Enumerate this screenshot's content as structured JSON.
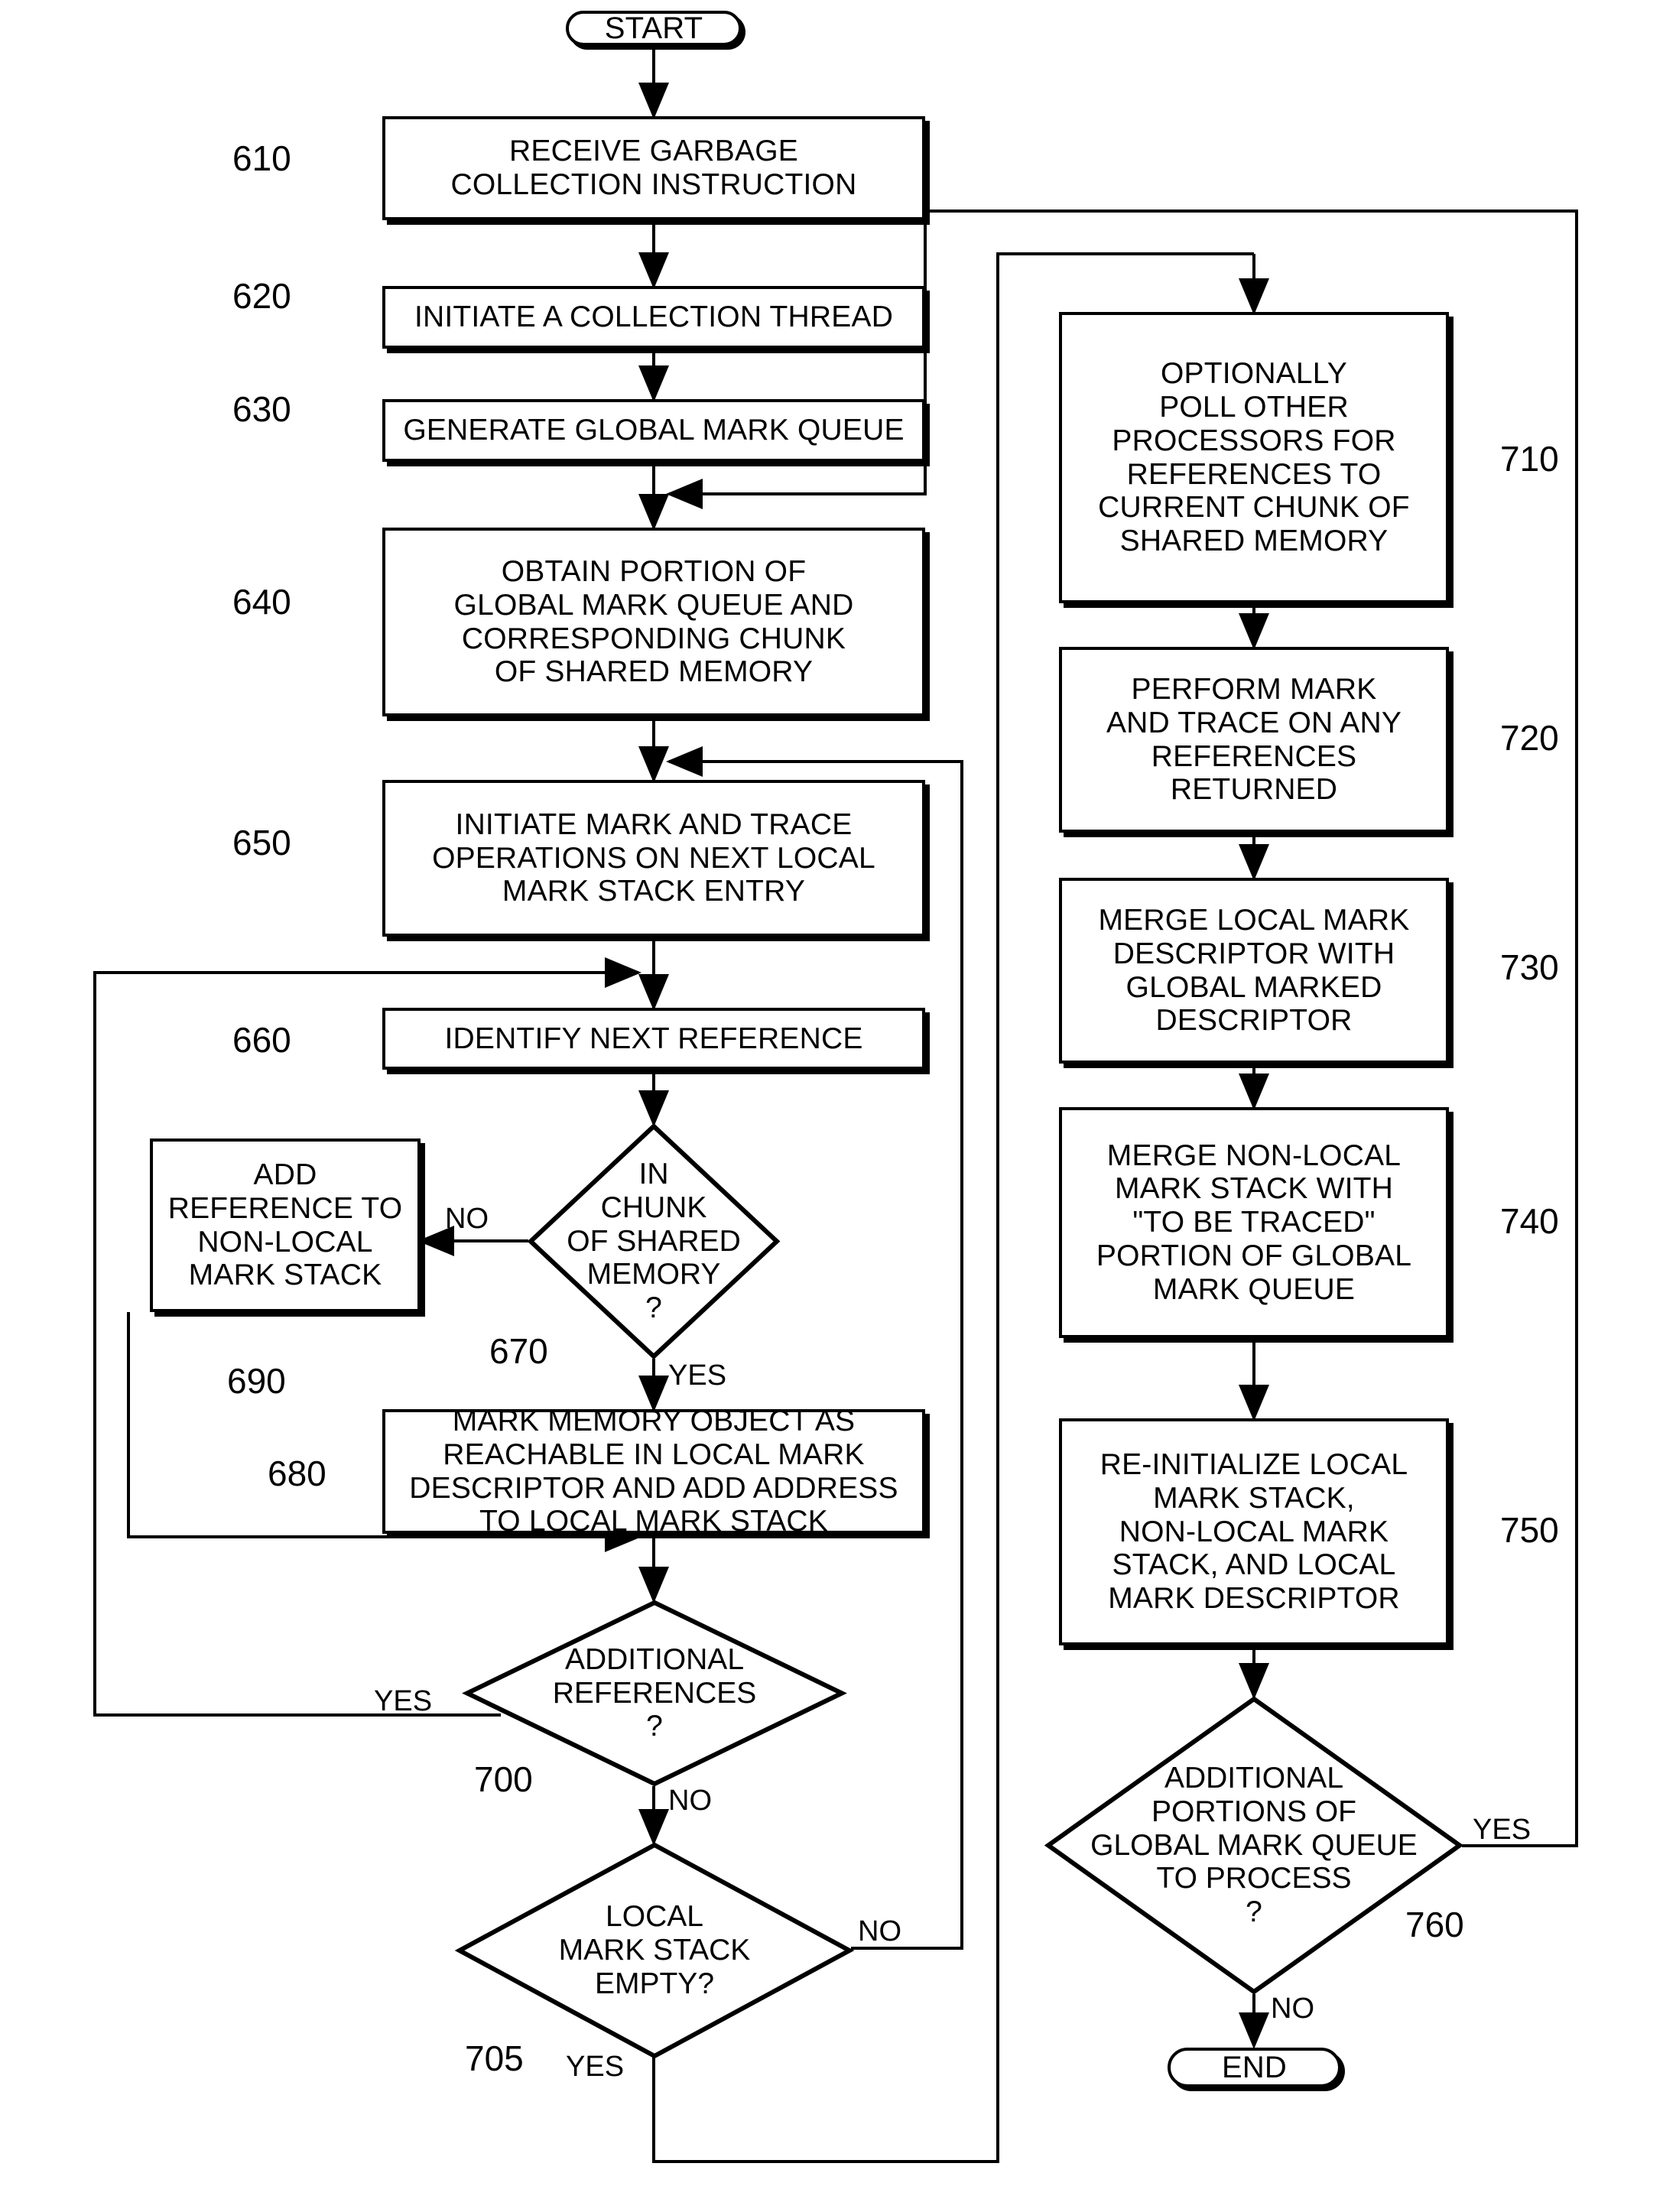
{
  "figure": {
    "type": "flowchart",
    "terminals": {
      "start": "START",
      "end": "END"
    }
  },
  "nodes": {
    "n610": {
      "ref": "610",
      "text": "RECEIVE GARBAGE\nCOLLECTION INSTRUCTION"
    },
    "n620": {
      "ref": "620",
      "text": "INITIATE A COLLECTION THREAD"
    },
    "n630": {
      "ref": "630",
      "text": "GENERATE GLOBAL MARK QUEUE"
    },
    "n640": {
      "ref": "640",
      "text": "OBTAIN PORTION OF\nGLOBAL MARK QUEUE AND\nCORRESPONDING CHUNK\nOF SHARED MEMORY"
    },
    "n650": {
      "ref": "650",
      "text": "INITIATE MARK AND TRACE\nOPERATIONS ON NEXT LOCAL\nMARK STACK ENTRY"
    },
    "n660": {
      "ref": "660",
      "text": "IDENTIFY NEXT REFERENCE"
    },
    "n670": {
      "ref": "670",
      "text": "IN\nCHUNK\nOF SHARED\nMEMORY\n?"
    },
    "n680": {
      "ref": "680",
      "text": "MARK MEMORY OBJECT AS\nREACHABLE IN LOCAL MARK\nDESCRIPTOR AND ADD ADDRESS\nTO LOCAL MARK STACK"
    },
    "n690": {
      "ref": "690",
      "text": "ADD\nREFERENCE TO\nNON-LOCAL\nMARK STACK"
    },
    "n700": {
      "ref": "700",
      "text": "ADDITIONAL\nREFERENCES\n?"
    },
    "n705": {
      "ref": "705",
      "text": "LOCAL\nMARK STACK\nEMPTY?"
    },
    "n710": {
      "ref": "710",
      "text": "OPTIONALLY\nPOLL OTHER\nPROCESSORS FOR\nREFERENCES TO\nCURRENT CHUNK OF\nSHARED MEMORY"
    },
    "n720": {
      "ref": "720",
      "text": "PERFORM MARK\nAND TRACE ON ANY\nREFERENCES\nRETURNED"
    },
    "n730": {
      "ref": "730",
      "text": "MERGE LOCAL MARK\nDESCRIPTOR WITH\nGLOBAL MARKED\nDESCRIPTOR"
    },
    "n740": {
      "ref": "740",
      "text": "MERGE NON-LOCAL\nMARK STACK WITH\n\"TO BE TRACED\"\nPORTION OF GLOBAL\nMARK QUEUE"
    },
    "n750": {
      "ref": "750",
      "text": "RE-INITIALIZE LOCAL\nMARK STACK,\nNON-LOCAL MARK\nSTACK, AND LOCAL\nMARK DESCRIPTOR"
    },
    "n760": {
      "ref": "760",
      "text": "ADDITIONAL\nPORTIONS OF\nGLOBAL MARK QUEUE\nTO PROCESS\n?"
    }
  },
  "edge_labels": {
    "e670_no": "NO",
    "e670_yes": "YES",
    "e700_yes": "YES",
    "e700_no": "NO",
    "e705_no": "NO",
    "e705_yes": "YES",
    "e760_yes": "YES",
    "e760_no": "NO"
  },
  "colors": {
    "stroke": "#000000",
    "fill": "#ffffff"
  }
}
